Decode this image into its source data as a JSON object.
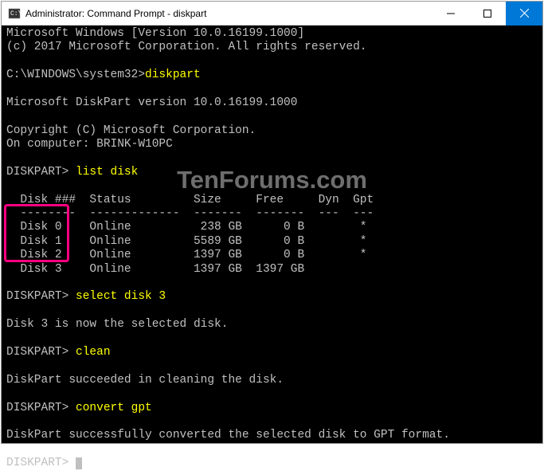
{
  "titlebar": {
    "title": "Administrator: Command Prompt - diskpart"
  },
  "terminal": {
    "line_os": "Microsoft Windows [Version 10.0.16199.1000]",
    "line_copyright": "(c) 2017 Microsoft Corporation. All rights reserved.",
    "prompt1": "C:\\WINDOWS\\system32>",
    "cmd1": "diskpart",
    "dp_version": "Microsoft DiskPart version 10.0.16199.1000",
    "dp_copyright": "Copyright (C) Microsoft Corporation.",
    "dp_computer": "On computer: BRINK-W10PC",
    "dp_prompt": "DISKPART> ",
    "cmd2": "list disk",
    "table_header": "  Disk ###  Status         Size     Free     Dyn  Gpt",
    "table_divider": "  --------  -------------  -------  -------  ---  ---",
    "table_rows": [
      "  Disk 0    Online          238 GB      0 B        *",
      "  Disk 1    Online         5589 GB      0 B        *",
      "  Disk 2    Online         1397 GB      0 B        *",
      "  Disk 3    Online         1397 GB  1397 GB"
    ],
    "cmd3": "select disk 3",
    "result_select": "Disk 3 is now the selected disk.",
    "cmd4": "clean",
    "result_clean": "DiskPart succeeded in cleaning the disk.",
    "cmd5": "convert gpt",
    "result_convert": "DiskPart successfully converted the selected disk to GPT format."
  },
  "watermark": "TenForums.com"
}
